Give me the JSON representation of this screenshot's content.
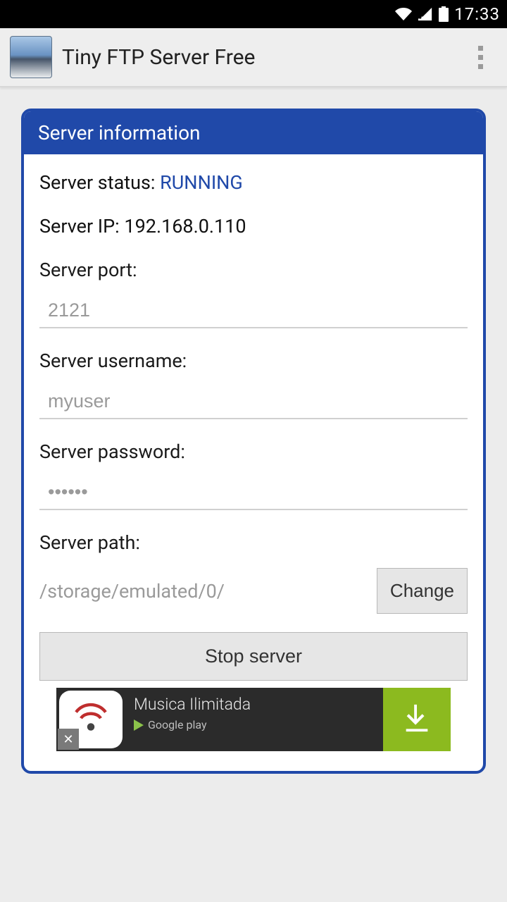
{
  "status_bar": {
    "time": "17:33"
  },
  "action_bar": {
    "title": "Tiny FTP Server Free"
  },
  "card": {
    "header": "Server information",
    "status_label": "Server status: ",
    "status_value": "RUNNING",
    "ip_label": "Server IP: ",
    "ip_value": "192.168.0.110",
    "port_label": "Server port:",
    "port_value": "2121",
    "user_label": "Server username:",
    "user_value": "myuser",
    "pass_label": "Server password:",
    "pass_value": "••••••",
    "path_label": "Server path:",
    "path_value": "/storage/emulated/0/",
    "change_btn": "Change",
    "stop_btn": "Stop server"
  },
  "ad": {
    "title": "Musica Ilimitada",
    "store": "Google play"
  }
}
